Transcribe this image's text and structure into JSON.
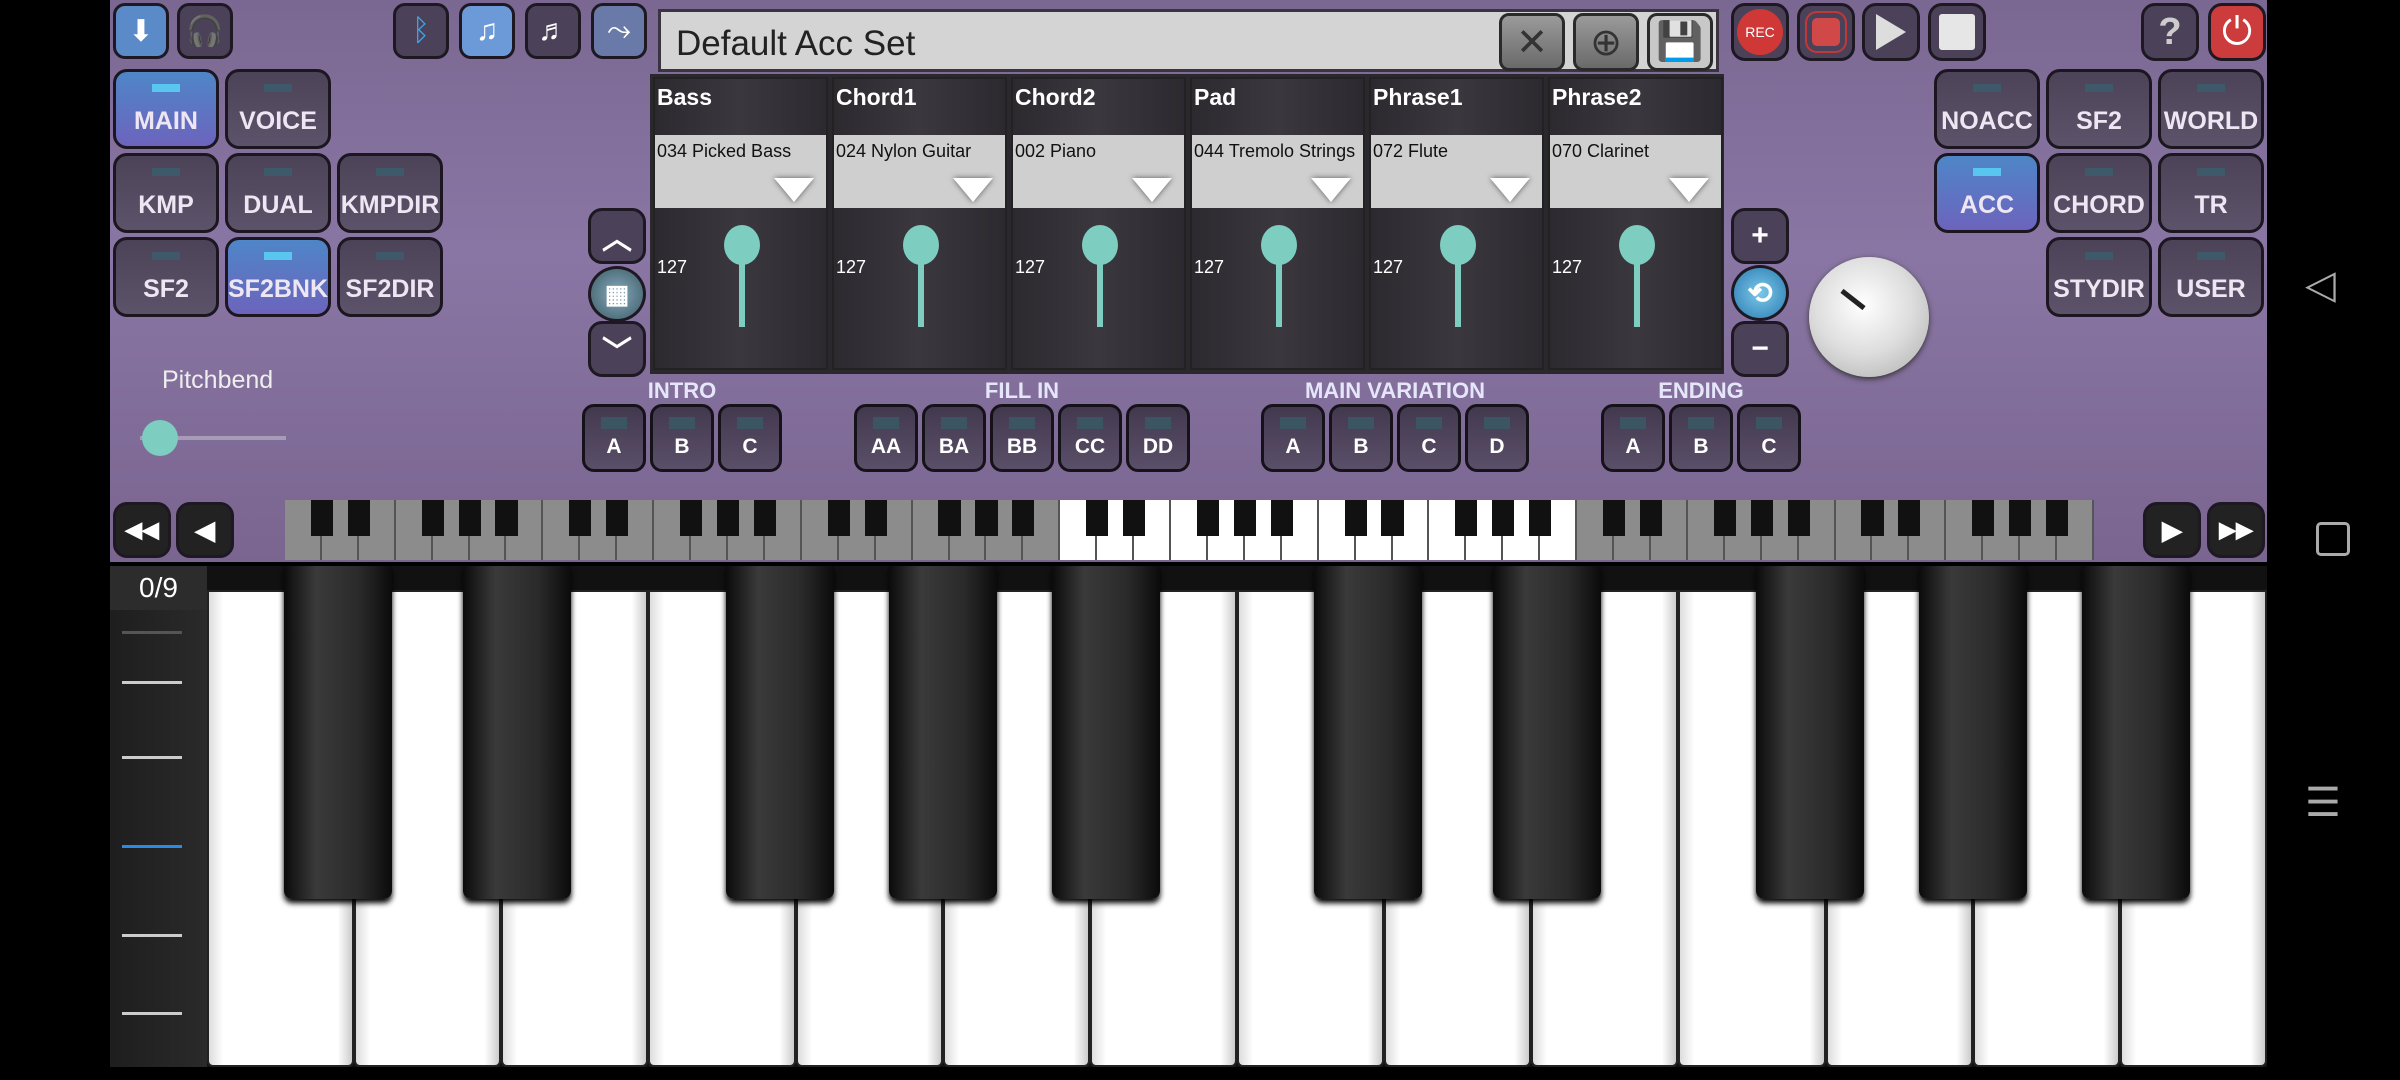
{
  "top_left_icons": [
    "folder-download-icon",
    "globe-headphones-icon"
  ],
  "top_mid_icons": [
    "bluetooth-icon",
    "music-folder-icon",
    "music-file-icon",
    "share-icon"
  ],
  "left_modes": [
    {
      "label": "MAIN",
      "active": true
    },
    {
      "label": "VOICE",
      "active": false
    },
    {
      "label": "KMP",
      "active": false
    },
    {
      "label": "DUAL",
      "active": false
    },
    {
      "label": "KMPDIR",
      "active": false
    },
    {
      "label": "SF2",
      "active": false
    },
    {
      "label": "SF2BNK",
      "active": true
    },
    {
      "label": "SF2DIR",
      "active": false
    }
  ],
  "pitchbend": {
    "label": "Pitchbend",
    "value": 0
  },
  "preset": {
    "name": "Default Acc Set",
    "close_icon": "close-icon",
    "add_icon": "add-circle-icon",
    "save_icon": "save-icon"
  },
  "transport": [
    "record-icon",
    "record-stop-icon",
    "play-icon",
    "stop-icon"
  ],
  "help_icon": "?",
  "power_icon": "power-icon",
  "right_modes": [
    {
      "label": "NOACC",
      "active": false
    },
    {
      "label": "SF2",
      "active": false
    },
    {
      "label": "WORLD",
      "active": false
    },
    {
      "label": "ACC",
      "active": true
    },
    {
      "label": "CHORD",
      "active": false
    },
    {
      "label": "TR",
      "active": false
    },
    {
      "label": "STYDIR",
      "active": false
    },
    {
      "label": "USER",
      "active": false
    }
  ],
  "transport_rec_label": "REC",
  "mixer": [
    {
      "name": "Bass",
      "instrument": "034  Picked Bass",
      "volume": "127"
    },
    {
      "name": "Chord1",
      "instrument": "024  Nylon Guitar",
      "volume": "127"
    },
    {
      "name": "Chord2",
      "instrument": "002  Piano",
      "volume": "127"
    },
    {
      "name": "Pad",
      "instrument": "044  Tremolo Strings",
      "volume": "127"
    },
    {
      "name": "Phrase1",
      "instrument": "072  Flute",
      "volume": "127"
    },
    {
      "name": "Phrase2",
      "instrument": "070  Clarinet",
      "volume": "127"
    }
  ],
  "sections": [
    {
      "label": "INTRO",
      "buttons": [
        "A",
        "B",
        "C"
      ]
    },
    {
      "label": "FILL IN",
      "buttons": [
        "AA",
        "BA",
        "BB",
        "CC",
        "DD"
      ]
    },
    {
      "label": "MAIN VARIATION",
      "buttons": [
        "A",
        "B",
        "C",
        "D"
      ]
    },
    {
      "label": "ENDING",
      "buttons": [
        "A",
        "B",
        "C"
      ]
    }
  ],
  "keyboard": {
    "counter": "0/9",
    "mini_white_keys": 49,
    "visible_range_start": 21,
    "visible_range_white_keys": 14
  },
  "colors": {
    "background": "#7d6b95",
    "accent_active": "#5a86c8",
    "slider": "#7ecdc1",
    "power": "#c83c3c"
  }
}
